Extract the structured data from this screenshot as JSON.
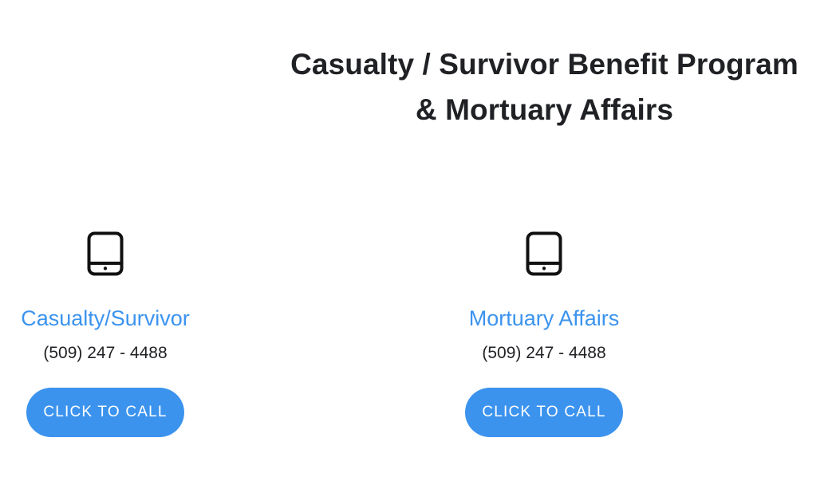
{
  "heading": {
    "line1": "Casualty / Survivor Benefit Program",
    "line2": "& Mortuary Affairs"
  },
  "contacts": [
    {
      "icon": "tablet-phone-icon",
      "title": "Casualty/Survivor",
      "phone": "(509) 247 - 4488",
      "button_label": "CLICK TO CALL"
    },
    {
      "icon": "tablet-phone-icon",
      "title": "Mortuary Affairs",
      "phone": "(509) 247 - 4488",
      "button_label": "CLICK TO CALL"
    }
  ],
  "colors": {
    "accent": "#3b93ee",
    "text": "#1f2124",
    "background": "#ffffff"
  }
}
